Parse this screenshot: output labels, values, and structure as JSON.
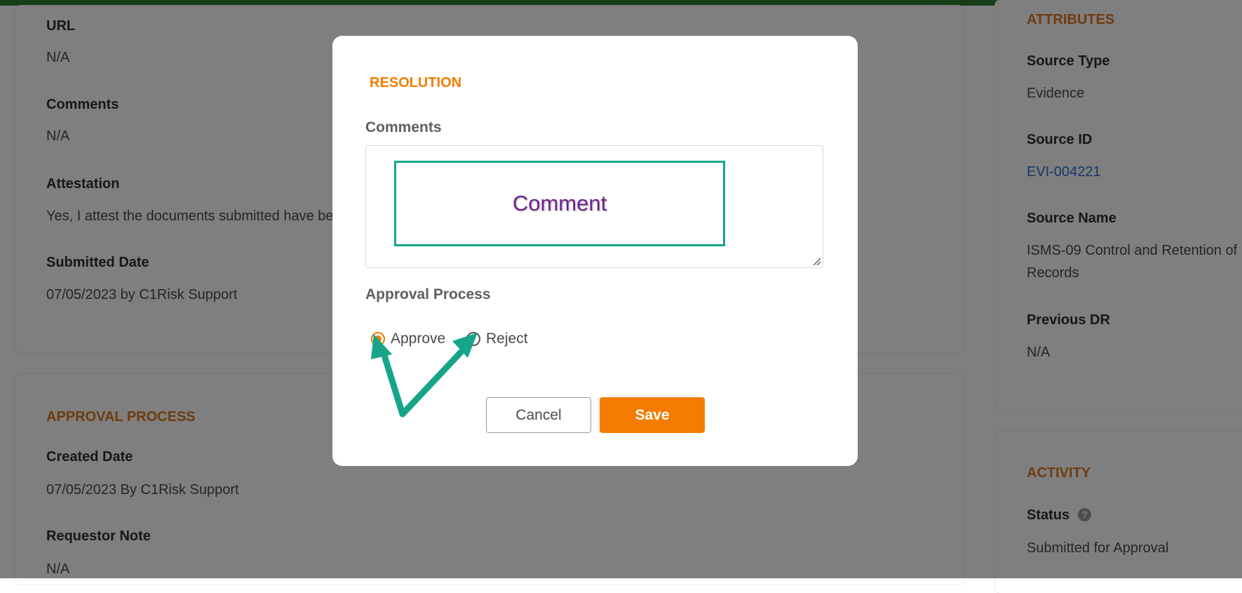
{
  "left_details": {
    "url_label": "URL",
    "url_value": "N/A",
    "comments_label": "Comments",
    "comments_value": "N/A",
    "attestation_label": "Attestation",
    "attestation_value": "Yes, I attest the documents submitted have be",
    "submitted_date_label": "Submitted Date",
    "submitted_date_value": "07/05/2023 by C1Risk Support"
  },
  "approval_section": {
    "title": "APPROVAL PROCESS",
    "created_date_label": "Created Date",
    "created_date_value": "07/05/2023 By C1Risk Support",
    "requestor_note_label": "Requestor Note",
    "requestor_note_value": "N/A"
  },
  "attributes": {
    "title": "ATTRIBUTES",
    "source_type_label": "Source Type",
    "source_type_value": "Evidence",
    "source_id_label": "Source ID",
    "source_id_value": "EVI-004221",
    "source_name_label": "Source Name",
    "source_name_line1": "ISMS-09 Control and Retention of",
    "source_name_line2": "Records",
    "previous_dr_label": "Previous DR",
    "previous_dr_value": "N/A"
  },
  "activity": {
    "title": "ACTIVITY",
    "status_label": "Status",
    "help_glyph": "?",
    "status_value": "Submitted for Approval"
  },
  "modal": {
    "title": "RESOLUTION",
    "comments_label": "Comments",
    "comments_value": "",
    "callout_text": "Comment",
    "approval_label": "Approval Process",
    "options": [
      {
        "label": "Approve",
        "selected": true
      },
      {
        "label": "Reject",
        "selected": false
      }
    ],
    "cancel_label": "Cancel",
    "save_label": "Save"
  },
  "colors": {
    "accent_orange": "#f57c00",
    "section_orange": "#e0771d",
    "annotation_green": "#17a58a",
    "top_bar_green": "#2e7d32",
    "link_blue": "#2f6fd0"
  }
}
